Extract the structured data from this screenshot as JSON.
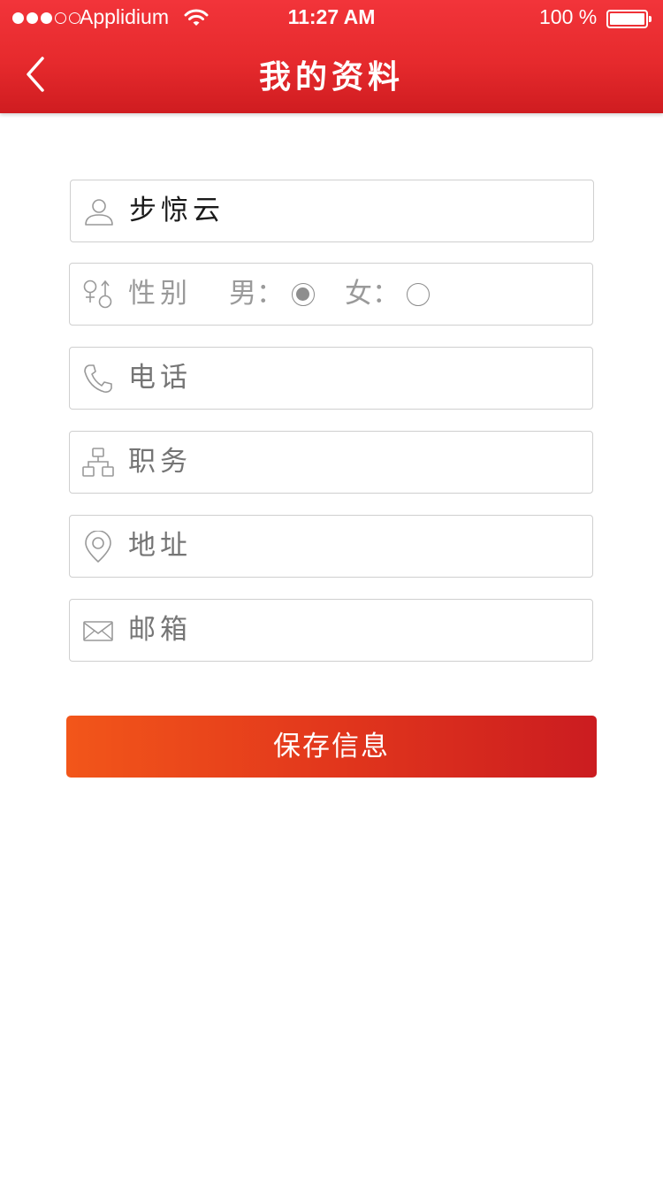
{
  "status_bar": {
    "carrier": "Applidium",
    "time": "11:27 AM",
    "battery": "100 %",
    "signal_dots_filled": 3,
    "signal_dots_total": 5
  },
  "nav": {
    "title": "我的资料",
    "back_icon": "chevron-left-icon"
  },
  "form": {
    "name": {
      "icon": "user-icon",
      "value": "步惊云"
    },
    "gender": {
      "icon": "gender-icon",
      "label": "性别",
      "male_label": "男：",
      "female_label": "女：",
      "selected": "male"
    },
    "phone": {
      "icon": "phone-icon",
      "placeholder": "电话"
    },
    "position": {
      "icon": "org-chart-icon",
      "placeholder": "职务"
    },
    "address": {
      "icon": "location-pin-icon",
      "placeholder": "地址"
    },
    "email": {
      "icon": "envelope-icon",
      "placeholder": "邮箱"
    }
  },
  "save_button": {
    "label": "保存信息"
  },
  "colors": {
    "header_red": "#e62a2d",
    "button_orange": "#f2561a",
    "button_red": "#cb1c20",
    "border": "#cfcfcf",
    "placeholder": "#9a9a9a"
  }
}
